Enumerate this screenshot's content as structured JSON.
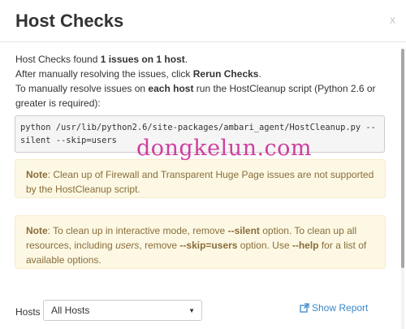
{
  "modal": {
    "title": "Host Checks",
    "close_label": "x"
  },
  "intro": {
    "line1_prefix": "Host Checks found ",
    "line1_bold": "1 issues on 1 host",
    "line1_suffix": ".",
    "line2_prefix": "After manually resolving the issues, click ",
    "line2_bold": "Rerun Checks",
    "line2_suffix": ".",
    "line3_prefix": "To manually resolve issues on ",
    "line3_bold": "each host",
    "line3_suffix": " run the HostCleanup script (Python 2.6 or greater is required):"
  },
  "code": {
    "command": "python /usr/lib/python2.6/site-packages/ambari_agent/HostCleanup.py --silent --skip=users"
  },
  "alerts": {
    "first": {
      "label": "Note",
      "text": ": Clean up of Firewall and Transparent Huge Page issues are not supported by the HostCleanup script."
    },
    "second": {
      "label": "Note",
      "t1": ": To clean up in interactive mode, remove ",
      "b1": "--silent",
      "t2": " option. To clean up all resources, including ",
      "i1": "users",
      "t3": ", remove ",
      "b2": "--skip=users",
      "t4": " option. Use ",
      "b3": "--help",
      "t5": " for a list of available options."
    }
  },
  "hosts": {
    "label": "Hosts",
    "selected": "All Hosts",
    "show_report_label": "Show Report"
  },
  "watermark": {
    "text": "dongkelun.com"
  },
  "colors": {
    "link": "#3a87c8",
    "warning_bg": "#fcf8e3",
    "warning_text": "#8a6d3b",
    "watermark": "#cc2f9a"
  },
  "icons": {
    "external": "external-link-icon",
    "caret": "caret-down-icon",
    "close": "close-icon"
  }
}
